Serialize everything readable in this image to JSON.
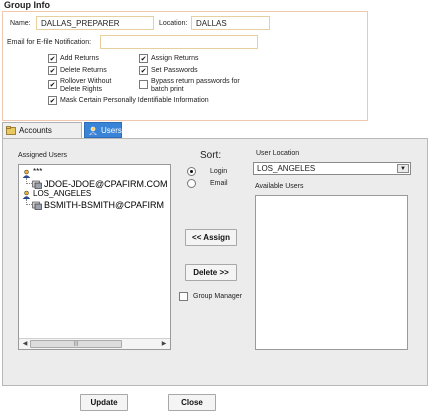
{
  "group_info": {
    "title": "Group Info",
    "name_label": "Name:",
    "name_value": "DALLAS_PREPARER",
    "location_label": "Location:",
    "location_value": "DALLAS",
    "email_label": "Email for E-file Notification:",
    "email_value": "",
    "permissions": [
      {
        "label": "Add Returns",
        "checked": true
      },
      {
        "label": "Assign Returns",
        "checked": true
      },
      {
        "label": "Delete Returns",
        "checked": true
      },
      {
        "label": "Set Passwords",
        "checked": true
      },
      {
        "label": "Rollover Without Delete Rights",
        "line1": "Rollover Without",
        "line2": "Delete Rights",
        "checked": true
      },
      {
        "label": "Bypass return passwords for batch print",
        "line1": "Bypass return passwords for",
        "line2": "batch print",
        "checked": false
      },
      {
        "label": "Mask Certain Personally Identifiable Information",
        "checked": true
      }
    ]
  },
  "tabs": [
    {
      "label": "Accounts",
      "icon": "accounts-icon",
      "active": false
    },
    {
      "label": "Users",
      "icon": "users-icon",
      "active": true
    }
  ],
  "users_panel": {
    "assigned_label": "Assigned Users",
    "tree": [
      {
        "label": "***",
        "type": "group"
      },
      {
        "label": "JDOE-JDOE@CPAFIRM.COM",
        "type": "user"
      },
      {
        "label": "LOS_ANGELES",
        "type": "group"
      },
      {
        "label": "BSMITH-BSMITH@CPAFIRM",
        "type": "user"
      }
    ],
    "sort": {
      "title": "Sort:",
      "options": [
        {
          "label": "Login",
          "selected": true
        },
        {
          "label": "Email",
          "selected": false
        }
      ]
    },
    "assign_button": "<< Assign",
    "delete_button": "Delete >>",
    "group_manager_label": "Group Manager",
    "group_manager_checked": false,
    "user_location_label": "User Location",
    "user_location_value": "LOS_ANGELES",
    "available_label": "Available Users",
    "available_users": []
  },
  "footer": {
    "update_label": "Update",
    "close_label": "Close"
  },
  "colors": {
    "tab_active": "#3a84d8",
    "group_border": "#f0c8b0",
    "panel_bg": "#ececec"
  }
}
